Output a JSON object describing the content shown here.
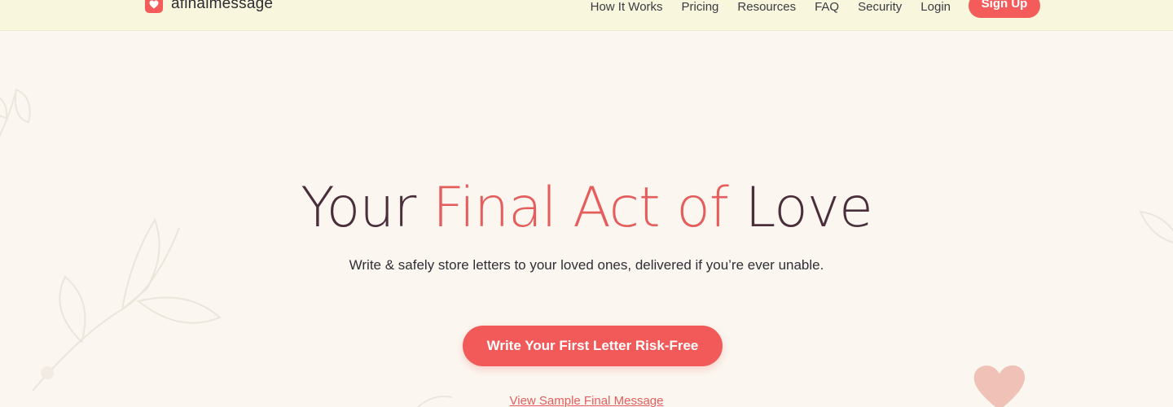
{
  "header": {
    "brand": "afinalmessage",
    "nav": [
      "How It Works",
      "Pricing",
      "Resources",
      "FAQ",
      "Security",
      "Login"
    ],
    "signup_label": "Sign Up"
  },
  "hero": {
    "title_part1": "Your ",
    "title_accent": "Final Act of",
    "title_part2": " Love",
    "subtitle": "Write & safely store letters to your loved ones, delivered if you’re ever unable.",
    "cta_label": "Write Your First Letter Risk-Free",
    "sample_link": "View Sample Final Message"
  },
  "colors": {
    "accent": "#f25a5a",
    "title": "#4a2e3c",
    "header_bg": "#f8f6dc",
    "page_bg": "#fbf7f0"
  },
  "icons": {
    "logo": "heart-icon",
    "decorations": [
      "leaf-branch-icon",
      "heart-icon"
    ]
  }
}
